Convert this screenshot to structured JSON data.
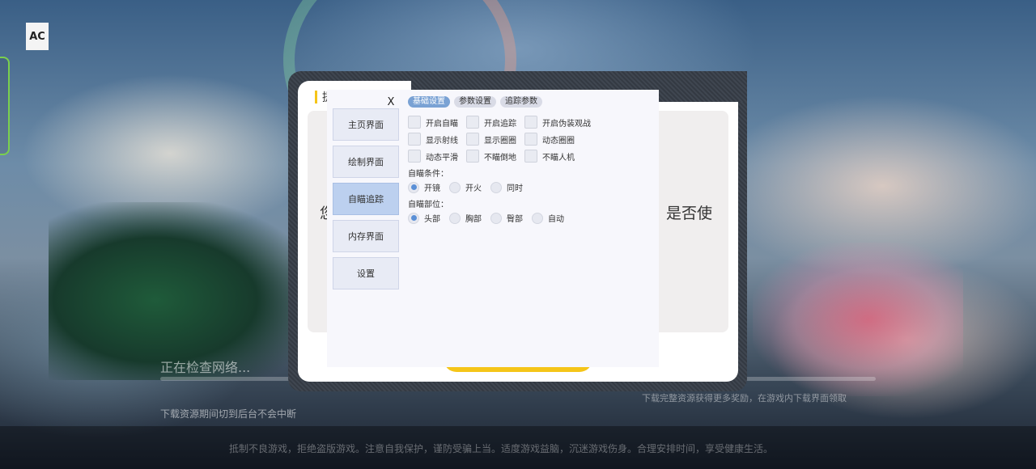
{
  "app": {
    "logo_text": "AC"
  },
  "loading": {
    "status": "正在检查网络...",
    "progress_fraction": 0.0,
    "notice_left": "下载资源期间切到后台不会中断",
    "notice_right": "下载完整资源获得更多奖励，在游戏内下载界面领取",
    "health_notice": "抵制不良游戏，拒绝盗版游戏。注意自我保护，谨防受骗上当。适度游戏益脑，沉迷游戏伤身。合理安排时间，享受健康生活。"
  },
  "dialog": {
    "title": "提",
    "text_left": "您",
    "text_right": "是否使"
  },
  "menu": {
    "close_label": "X",
    "side_items": [
      {
        "label": "主页界面",
        "active": false
      },
      {
        "label": "绘制界面",
        "active": false
      },
      {
        "label": "自瞄追踪",
        "active": true
      },
      {
        "label": "内存界面",
        "active": false
      },
      {
        "label": "设置",
        "active": false
      }
    ],
    "tabs": [
      {
        "label": "基础设置",
        "active": true
      },
      {
        "label": "参数设置",
        "active": false
      },
      {
        "label": "追踪参数",
        "active": false
      }
    ],
    "checkboxes": [
      [
        "开启自瞄",
        "开启追踪",
        "开启伪装观战"
      ],
      [
        "显示射线",
        "显示圈圈",
        "动态圈圈"
      ],
      [
        "动态平滑",
        "不瞄倒地",
        "不瞄人机"
      ]
    ],
    "aim_condition": {
      "label": "自瞄条件：",
      "options": [
        "开镜",
        "开火",
        "同时"
      ],
      "selected": 0
    },
    "aim_part": {
      "label": "自瞄部位：",
      "options": [
        "头部",
        "胸部",
        "臀部",
        "自动"
      ],
      "selected": 0
    }
  },
  "colors": {
    "accent_yellow": "#f5c518",
    "active_tab": "#7aa2d4",
    "active_side": "#bcd0ef",
    "radio_on": "#5a8fd6"
  }
}
